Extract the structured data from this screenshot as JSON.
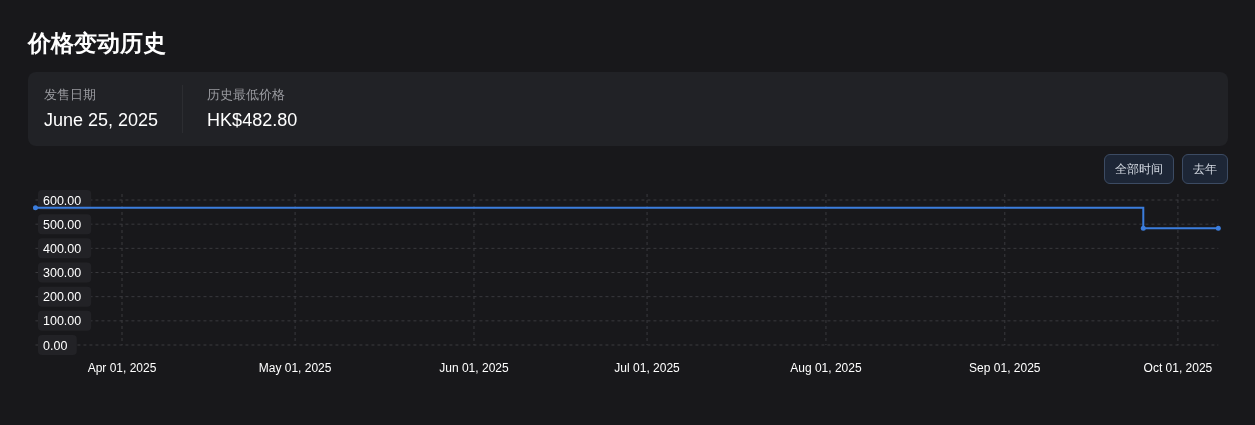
{
  "title": "价格变动历史",
  "stats": [
    {
      "label": "发售日期",
      "value": "June 25, 2025"
    },
    {
      "label": "历史最低价格",
      "value": "HK$482.80"
    }
  ],
  "range_buttons": [
    "全部时间",
    "去年"
  ],
  "chart_data": {
    "type": "line",
    "x": [
      "2025-03-17",
      "2025-09-25",
      "2025-09-25",
      "2025-10-08"
    ],
    "xlim": [
      "2025-03-17",
      "2025-10-08"
    ],
    "grid": true,
    "series": [
      {
        "color": "#3b7ddd",
        "values": [
          568,
          568,
          483,
          483
        ]
      }
    ],
    "ylim": [
      0,
      600
    ],
    "yticks": [
      {
        "value": 0,
        "label": "0.00"
      },
      {
        "value": 100,
        "label": "100.00"
      },
      {
        "value": 200,
        "label": "200.00"
      },
      {
        "value": 300,
        "label": "300.00"
      },
      {
        "value": 400,
        "label": "400.00"
      },
      {
        "value": 500,
        "label": "500.00"
      },
      {
        "value": 600,
        "label": "600.00"
      }
    ],
    "xticks": [
      {
        "value": "2025-04-01",
        "label": "Apr 01, 2025"
      },
      {
        "value": "2025-05-01",
        "label": "May 01, 2025"
      },
      {
        "value": "2025-06-01",
        "label": "Jun 01, 2025"
      },
      {
        "value": "2025-07-01",
        "label": "Jul 01, 2025"
      },
      {
        "value": "2025-08-01",
        "label": "Aug 01, 2025"
      },
      {
        "value": "2025-09-01",
        "label": "Sep 01, 2025"
      },
      {
        "value": "2025-10-01",
        "label": "Oct 01, 2025"
      }
    ]
  }
}
